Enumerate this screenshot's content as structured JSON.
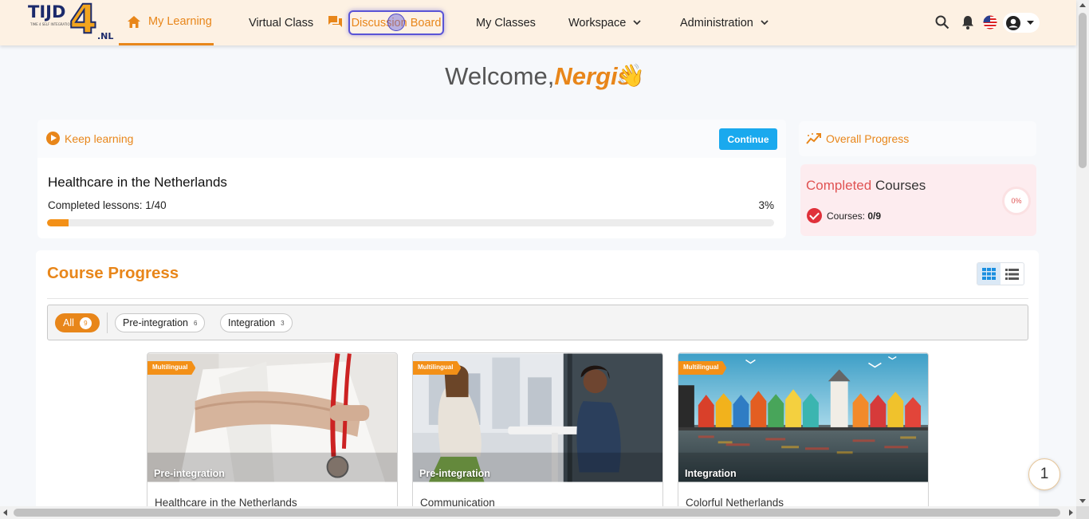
{
  "logo": {
    "text_tijd": "TIJD",
    "text_4": "4",
    "text_nl": ".NL",
    "tagline": "TIME 4 SELF INTEGRATION"
  },
  "nav": {
    "my_learning": "My Learning",
    "virtual_class": "Virtual Class",
    "discussion_board": "Discussion Board",
    "my_classes": "My Classes",
    "workspace": "Workspace",
    "administration": "Administration"
  },
  "welcome": {
    "prefix": "Welcome,",
    "name": "Nergis",
    "emoji": "👋"
  },
  "keep_learning": {
    "title": "Keep learning",
    "continue_label": "Continue",
    "course_title": "Healthcare in the Netherlands",
    "lessons_label": "Completed lessons: 1/40",
    "percent_label": "3%",
    "progress": 0.03
  },
  "overall": {
    "title": "Overall Progress",
    "completed_accent": "Completed",
    "completed_rest": " Courses",
    "courses_label": "Courses: ",
    "courses_value": "0/9",
    "ring_label": "0%"
  },
  "course_progress": {
    "title": "Course Progress",
    "filters": [
      {
        "label": "All",
        "count": "9"
      },
      {
        "label": "Pre-integration",
        "count": "6"
      },
      {
        "label": "Integration",
        "count": "3"
      }
    ],
    "cards": [
      {
        "ribbon": "Multilingual",
        "category": "Pre-integration",
        "title": "Healthcare in the Netherlands"
      },
      {
        "ribbon": "Multilingual",
        "category": "Pre-integration",
        "title": "Communication"
      },
      {
        "ribbon": "Multilingual",
        "category": "Integration",
        "title": "Colorful Netherlands"
      }
    ]
  },
  "fab": {
    "label": "1"
  },
  "colors": {
    "accent": "#e8861a",
    "blue": "#1aa9ee",
    "header_bg": "#fdf1e3"
  }
}
